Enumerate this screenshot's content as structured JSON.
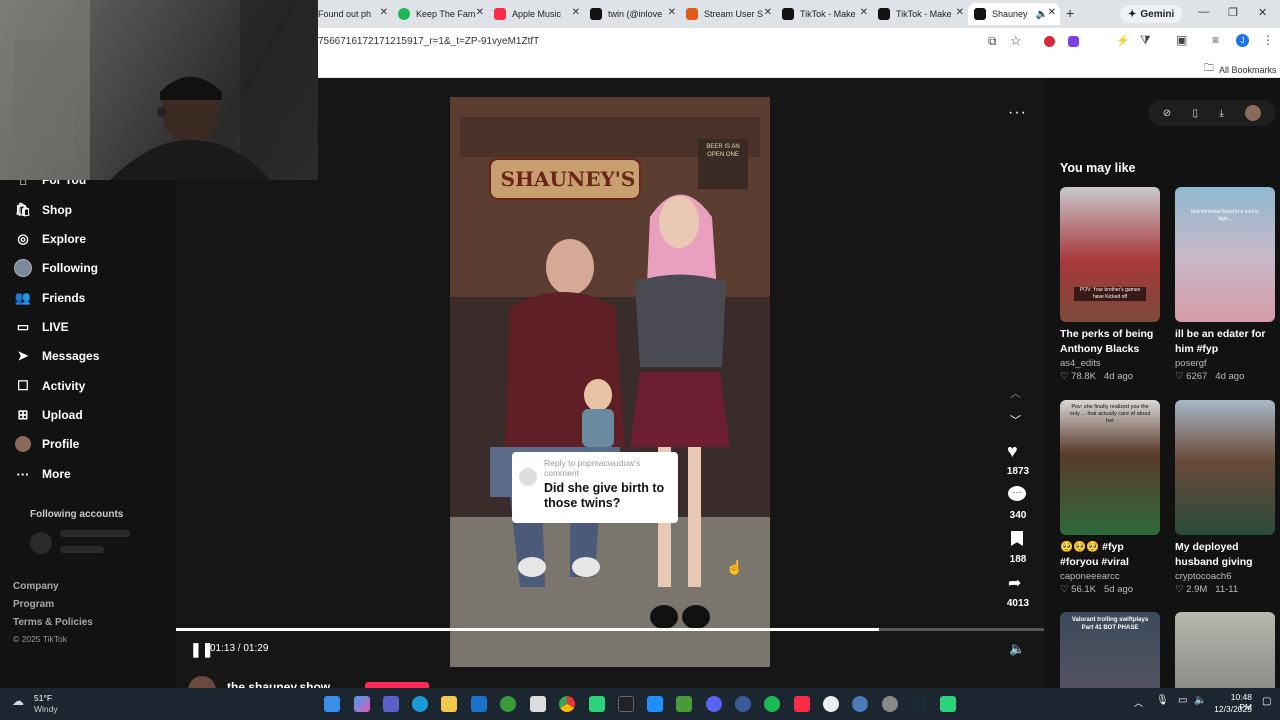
{
  "browser": {
    "tabs": [
      {
        "label": "Found out ph",
        "color": "#888"
      },
      {
        "label": "Keep The Fam",
        "color": "#1db954"
      },
      {
        "label": "Apple Music",
        "color": "#fa2d48"
      },
      {
        "label": "twin (@inlove",
        "color": "#000"
      },
      {
        "label": "Stream User S",
        "color": "#e05a1a"
      },
      {
        "label": "TikTok - Make",
        "color": "#000"
      },
      {
        "label": "TikTok - Make",
        "color": "#000"
      },
      {
        "label": "Shauney",
        "color": "#000"
      }
    ],
    "gemini": "Gemini",
    "url": "7566716172171215917_r=1&_t=ZP-91vyeM1ZtfT",
    "bookmarks": "All Bookmarks"
  },
  "sidebar": {
    "items": [
      {
        "label": "For You",
        "icon": "home-icon"
      },
      {
        "label": "Shop",
        "icon": "shop-icon"
      },
      {
        "label": "Explore",
        "icon": "compass-icon"
      },
      {
        "label": "Following",
        "icon": "avatar-icon"
      },
      {
        "label": "Friends",
        "icon": "friends-icon"
      },
      {
        "label": "LIVE",
        "icon": "live-icon"
      },
      {
        "label": "Messages",
        "icon": "messages-icon"
      },
      {
        "label": "Activity",
        "icon": "activity-icon"
      },
      {
        "label": "Upload",
        "icon": "upload-icon"
      },
      {
        "label": "Profile",
        "icon": "profile-icon"
      },
      {
        "label": "More",
        "icon": "more-icon"
      }
    ],
    "following_title": "Following accounts",
    "footer": [
      "Company",
      "Program",
      "Terms & Policies"
    ],
    "copyright": "© 2025 TikTok"
  },
  "video": {
    "reply_label": "Reply to popmacwuduw's comment",
    "reply_text": "Did she give birth to those twins?",
    "time": "01:13 / 01:29",
    "progress": 0.81,
    "author": "the.shauney.show",
    "sign_text": "SHAUNEY'S",
    "beer_text": "BEER IS AN OPEN ONE"
  },
  "actions": {
    "likes": "1873",
    "comments": "340",
    "saves": "188",
    "shares": "4013"
  },
  "suggestions": {
    "title": "You may like",
    "cards": [
      {
        "title": "The perks of being Anthony Blacks littl...",
        "author": "as4_edits",
        "likes": "78.8K",
        "age": "4d ago",
        "caption": "POV: Your brother's games have Kicked off"
      },
      {
        "title": "ill be an edater for him #fyp #valorant...",
        "author": "posergf",
        "likes": "6267",
        "age": "4d ago",
        "caption": "that immortal found in a soul is high..."
      },
      {
        "title": "🥺🥺🥺 #fyp #foryou #viral #fyp...",
        "author": "caponeeearcc",
        "likes": "56.1K",
        "age": "5d ago",
        "caption": "Pov: she finally realized you the only ... that actually care af about her"
      },
      {
        "title": "My deployed husband giving the...",
        "author": "cryptocoach6",
        "likes": "2.9M",
        "age": "11-11",
        "caption": ""
      },
      {
        "title": "",
        "author": "",
        "likes": "",
        "age": "",
        "caption": "Valorant trolling swiftplays Part 41 BOT PHASE"
      },
      {
        "title": "",
        "author": "",
        "likes": "",
        "age": "",
        "caption": ""
      }
    ]
  },
  "taskbar": {
    "temp": "51°F",
    "weather": "Windy",
    "time": "10:48 PM",
    "date": "12/3/2025"
  }
}
